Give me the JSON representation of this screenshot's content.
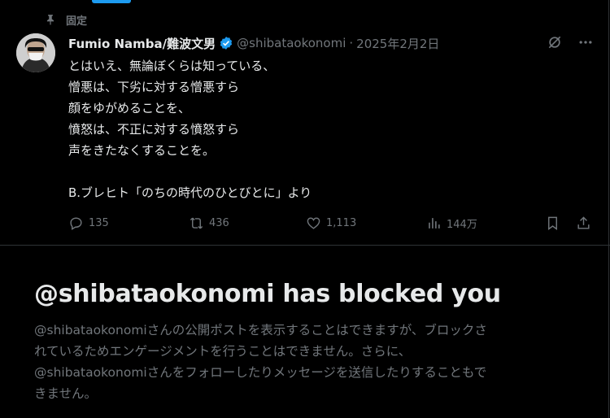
{
  "pinned": {
    "label": "固定"
  },
  "tweet": {
    "author_name": "Fumio Namba/難波文男",
    "handle": "@shibataokonomi",
    "separator": "·",
    "date": "2025年2月2日",
    "lines": [
      "とはいえ、無論ぼくらは知っている、",
      "憎悪は、下劣に対する憎悪すら",
      "顔をゆがめることを、",
      "憤怒は、不正に対する憤怒すら",
      "声をきたなくすることを。",
      "",
      "B.ブレヒト「のちの時代のひとびとに」より"
    ],
    "replies": "135",
    "retweets": "436",
    "likes": "1,113",
    "views": "144万"
  },
  "block": {
    "title": "@shibataokonomi has blocked you",
    "lines": [
      "@shibataokonomiさんの公開ポストを表示することはできますが、ブロックさ",
      "れているためエンゲージメントを行うことはできません。さらに、",
      "@shibataokonomiさんをフォローしたりメッセージを送信したりすることもで",
      "きません。"
    ]
  },
  "colors": {
    "background": "#000000",
    "text": "#e7e9ea",
    "muted": "#71767b",
    "accent": "#1d9bf0",
    "border": "#2f3336"
  },
  "icons": [
    "pin-icon",
    "verified-badge-icon",
    "grok-icon",
    "more-icon",
    "reply-icon",
    "retweet-icon",
    "like-icon",
    "views-icon",
    "bookmark-icon",
    "share-icon"
  ]
}
